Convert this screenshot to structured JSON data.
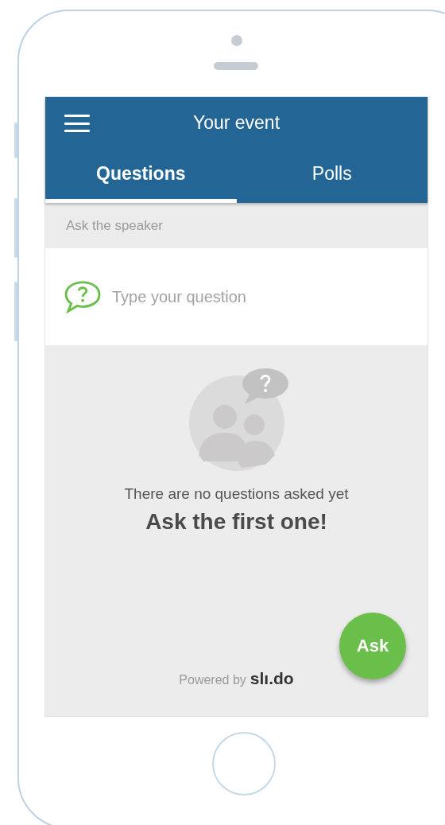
{
  "app_bar": {
    "title": "Your event"
  },
  "tabs": [
    {
      "label": "Questions",
      "selected": true
    },
    {
      "label": "Polls",
      "selected": false
    }
  ],
  "section_label": "Ask the speaker",
  "question_field": {
    "placeholder": "Type your question"
  },
  "empty_state": {
    "message": "There are no questions asked yet",
    "call_to_action": "Ask the first one!"
  },
  "ask_button": "Ask",
  "footer": {
    "powered_by": "Powered by",
    "logo": "slı.do"
  }
}
